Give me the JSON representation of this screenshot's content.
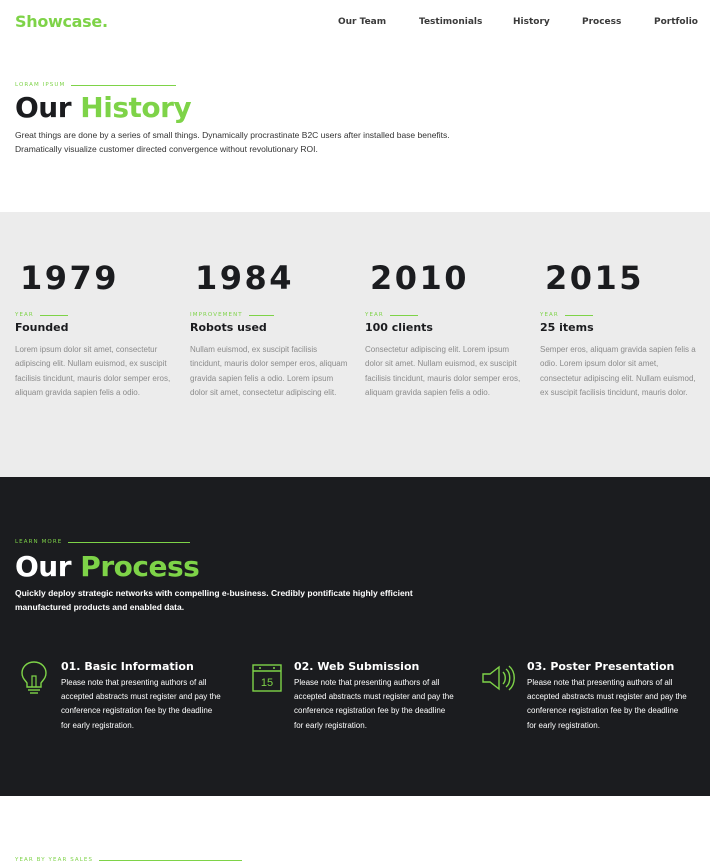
{
  "header": {
    "logo": "Showcase.",
    "nav": [
      "Our Team",
      "Testimonials",
      "History",
      "Process",
      "Portfolio"
    ]
  },
  "history": {
    "eyebrow": "LORAM IPSUM",
    "title_dark": "Our",
    "title_green": "History",
    "lead": "Great things are done by a series of small things. Dynamically procrastinate B2C users after installed base benefits. Dramatically visualize customer directed convergence without revolutionary ROI.",
    "milestones": [
      {
        "year": "1979",
        "label": "YEAR",
        "title": "Founded",
        "text": "Lorem ipsum dolor sit amet, consectetur adipiscing elit. Nullam euismod, ex suscipit facilisis tincidunt, mauris dolor semper eros, aliquam gravida sapien felis a odio."
      },
      {
        "year": "1984",
        "label": "IMPROVEMENT",
        "title": "Robots used",
        "text": "Nullam euismod, ex suscipit facilisis tincidunt, mauris dolor semper eros, aliquam gravida sapien felis a odio. Lorem ipsum dolor sit amet, consectetur adipiscing elit."
      },
      {
        "year": "2010",
        "label": "YEAR",
        "title": "100 clients",
        "text": "Consectetur adipiscing elit. Lorem ipsum dolor sit amet. Nullam euismod, ex suscipit facilisis tincidunt, mauris dolor semper eros, aliquam gravida sapien felis a odio."
      },
      {
        "year": "2015",
        "label": "YEAR",
        "title": "25 items",
        "text": "Semper eros, aliquam gravida sapien felis a odio. Lorem ipsum dolor sit amet, consectetur adipiscing elit. Nullam euismod, ex suscipit facilisis tincidunt, mauris dolor."
      }
    ]
  },
  "process": {
    "eyebrow": "LEARN MORE",
    "title_dark": "Our",
    "title_green": "Process",
    "lead": "Quickly deploy strategic networks with compelling e-business. Credibly pontificate highly efficient manufactured products and enabled data.",
    "steps": [
      {
        "icon": "lightbulb-icon",
        "title": "01. Basic Information",
        "text": "Please note that presenting authors of all accepted abstracts must register and pay the conference registration fee by the deadline for early registration."
      },
      {
        "icon": "calendar-icon",
        "calendar_day": "15",
        "title": "02. Web Submission",
        "text": "Please note that presenting authors of all accepted abstracts must register and pay the conference registration fee by the deadline for early registration."
      },
      {
        "icon": "megaphone-icon",
        "title": "03. Poster Presentation",
        "text": "Please note that presenting authors of all accepted abstracts must register and pay the conference registration fee by the deadline for early registration."
      }
    ]
  },
  "sales": {
    "eyebrow": "YEAR BY YEAR SALES"
  },
  "colors": {
    "accent": "#7ed348",
    "dark_band": "#1b1c1f",
    "light_band": "#ececec"
  }
}
